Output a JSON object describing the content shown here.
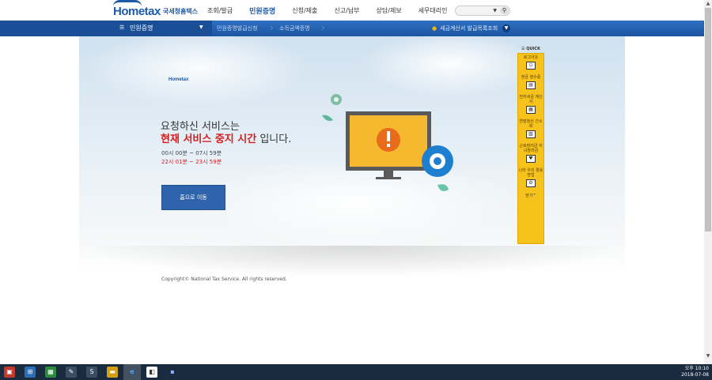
{
  "header": {
    "logo_text": "Hometax",
    "logo_sub": "국세청홈택스",
    "nav": [
      "조회/발급",
      "민원증명",
      "신청/제출",
      "신고/납부",
      "상담/제보",
      "세무대리인"
    ],
    "active_nav": "민원증명"
  },
  "subnav": {
    "title": "민원증명",
    "breadcrumbs": [
      "민원증명발급신청",
      "소득금액증명"
    ],
    "right_link": "세금계산서 발급목록조회"
  },
  "main": {
    "line1": "요청하신 서비스는",
    "line2_highlight": "현재 서비스 중지 시간",
    "line2_rest": " 입니다.",
    "time_range_1": "00시 00분 ~ 07시 59분",
    "time_range_2": "22시 01분 ~ 23시 59분",
    "button_label": "홈으로 이동",
    "copyright": "Copyright© National Tax Service. All rights reserved."
  },
  "quick": {
    "header": "QUICK",
    "items": [
      {
        "label": "로그아웃",
        "icon": "logout-icon"
      },
      {
        "label": "현금 영수증",
        "icon": "receipt-icon"
      },
      {
        "label": "전자세금 계산서",
        "icon": "invoice-icon"
      },
      {
        "label": "연말정산 간소화",
        "icon": "tax-settlement-icon"
      },
      {
        "label": "근로장려금 자녀장려금",
        "icon": "incentive-icon"
      },
      {
        "label": "나라 우리 활용방법",
        "icon": "settings-icon"
      }
    ],
    "close_label": "닫기"
  },
  "taskbar": {
    "time": "오후 10:10",
    "date": "2018-07-08"
  },
  "colors": {
    "brand_blue": "#1e5aa8",
    "nav_blue": "#2e6fc0",
    "alert_red": "#d61e1e",
    "quick_yellow": "#f6c21c"
  }
}
